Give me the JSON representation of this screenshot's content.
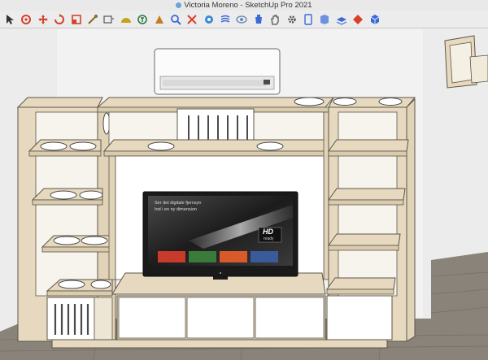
{
  "window": {
    "title": "Victoria Moreno - SketchUp Pro 2021"
  },
  "toolbar": {
    "tools": [
      {
        "name": "select-tool",
        "icon": "arrow-icon",
        "color": "#333333"
      },
      {
        "name": "orbit-tool",
        "icon": "orbit-icon",
        "color": "#d8402a"
      },
      {
        "name": "move-tool",
        "icon": "move-icon",
        "color": "#d8402a"
      },
      {
        "name": "rotate-tool",
        "icon": "rotate-icon",
        "color": "#d8402a"
      },
      {
        "name": "scale-tool",
        "icon": "scale-icon",
        "color": "#d8402a"
      },
      {
        "name": "tape-tool",
        "icon": "tape-icon",
        "color": "#8a6a2a"
      },
      {
        "name": "dimension-tool",
        "icon": "dimension-icon",
        "color": "#555555"
      },
      {
        "name": "protractor-tool",
        "icon": "protractor-icon",
        "color": "#c8a020"
      },
      {
        "name": "text-tool",
        "icon": "text-icon",
        "color": "#2a7a3a"
      },
      {
        "name": "section-tool",
        "icon": "section-icon",
        "color": "#c87a20"
      },
      {
        "name": "zoom-tool",
        "icon": "zoom-icon",
        "color": "#3a6ad8"
      },
      {
        "name": "zoom-extents-tool",
        "icon": "zoom-extents-icon",
        "color": "#d8402a"
      },
      {
        "name": "position-camera-tool",
        "icon": "camera-icon",
        "color": "#3a8ad8"
      },
      {
        "name": "walk-tool",
        "icon": "walk-icon",
        "color": "#3a6ad8"
      },
      {
        "name": "look-around-tool",
        "icon": "eye-icon",
        "color": "#6a8ab8"
      },
      {
        "name": "paint-tool",
        "icon": "bucket-icon",
        "color": "#3a6ad8"
      },
      {
        "name": "pan-tool",
        "icon": "hand-icon",
        "color": "#555555"
      },
      {
        "name": "settings-tool",
        "icon": "gear-icon",
        "color": "#555555"
      },
      {
        "name": "components-tool",
        "icon": "component-icon",
        "color": "#3a6ad8"
      },
      {
        "name": "styles-tool",
        "icon": "styles-icon",
        "color": "#3a6ad8"
      },
      {
        "name": "layers-tool",
        "icon": "layers-icon",
        "color": "#3a6ad8"
      },
      {
        "name": "warehouse-tool",
        "icon": "warehouse-icon",
        "color": "#d8402a"
      },
      {
        "name": "extension-tool",
        "icon": "cube-icon",
        "color": "#3a6ad8"
      }
    ]
  },
  "tv": {
    "screen_line1": "Ser det digitale fjernsyn",
    "screen_line2": "Ind i en ny dimension",
    "badge_main": "HD",
    "badge_sub": "ready"
  },
  "colors": {
    "wood": "#e6d9bf",
    "wood_edge": "#5c5648",
    "white_panel": "#ffffff",
    "floor": "#8a837a",
    "wall": "#f2f2f2"
  }
}
